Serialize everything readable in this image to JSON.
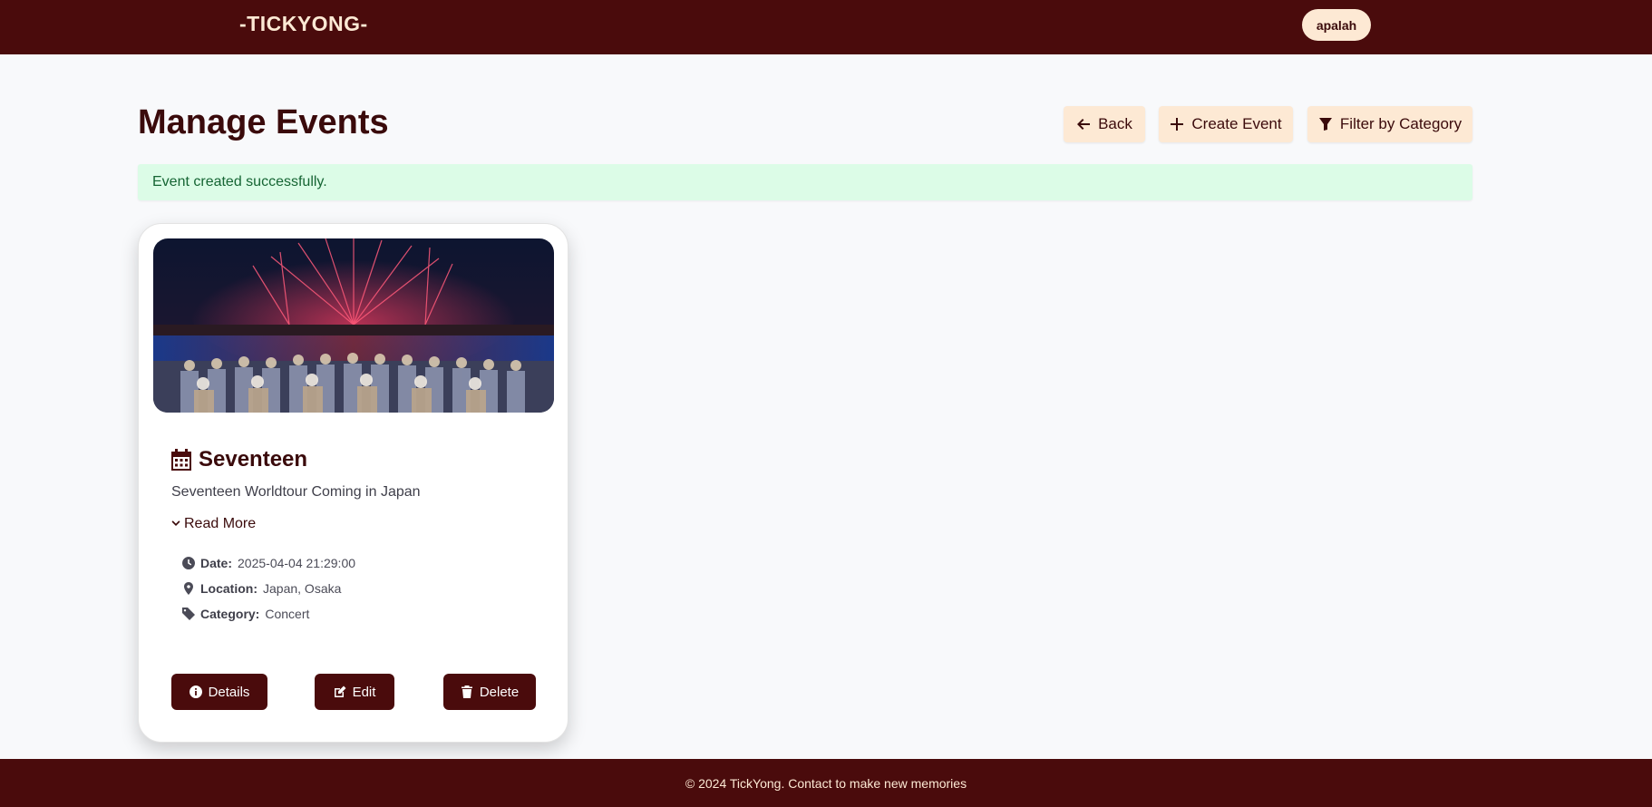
{
  "navbar": {
    "brand": "-TICKYONG-",
    "user": "apalah"
  },
  "header": {
    "title": "Manage Events",
    "buttons": {
      "back": "Back",
      "create": "Create Event",
      "filter": "Filter by Category"
    }
  },
  "alert": {
    "message": "Event created successfully."
  },
  "events": [
    {
      "title": "Seventeen",
      "description": "Seventeen Worldtour Coming in Japan",
      "read_more": "Read More",
      "date_label": "Date:",
      "date": "2025-04-04 21:29:00",
      "location_label": "Location:",
      "location": "Japan, Osaka",
      "category_label": "Category:",
      "category": "Concert",
      "actions": {
        "details": "Details",
        "edit": "Edit",
        "delete": "Delete"
      }
    }
  ],
  "footer": {
    "text": "© 2024 TickYong. Contact to make new memories"
  },
  "colors": {
    "primary": "#4a0b0c",
    "accent": "#fde9d4",
    "success_bg": "#dcfce7",
    "success_text": "#166534"
  },
  "icons": {
    "back": "arrow-left-icon",
    "create": "plus-icon",
    "filter": "filter-icon",
    "title": "calendar-icon",
    "read_more": "chevron-down-icon",
    "date": "clock-icon",
    "location": "map-pin-icon",
    "category": "tag-icon",
    "details": "info-icon",
    "edit": "edit-icon",
    "delete": "trash-icon"
  }
}
